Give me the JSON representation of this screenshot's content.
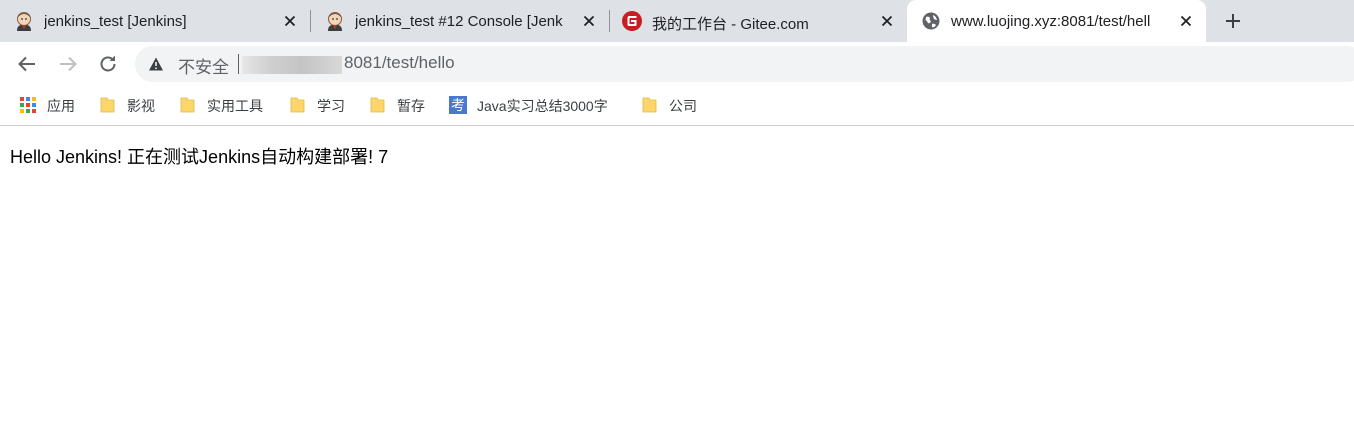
{
  "tabs": [
    {
      "title": "jenkins_test [Jenkins]",
      "icon": "jenkins-icon",
      "active": false
    },
    {
      "title": "jenkins_test #12 Console [Jenk",
      "icon": "jenkins-icon",
      "active": false
    },
    {
      "title": "我的工作台 - Gitee.com",
      "icon": "gitee-icon",
      "active": false
    },
    {
      "title": "www.luojing.xyz:8081/test/hell",
      "icon": "globe-icon",
      "active": true
    }
  ],
  "omnibox": {
    "security_label": "不安全",
    "separator": "|",
    "url_visible": "8081/test/hello"
  },
  "bookmarks": [
    {
      "label": "应用",
      "icon": "apps-grid-icon"
    },
    {
      "label": "影视",
      "icon": "folder-icon"
    },
    {
      "label": "实用工具",
      "icon": "folder-icon"
    },
    {
      "label": "学习",
      "icon": "folder-icon"
    },
    {
      "label": "暂存",
      "icon": "folder-icon"
    },
    {
      "label": "Java实习总结3000字",
      "icon": "kao-icon",
      "icon_char": "考"
    },
    {
      "label": "公司",
      "icon": "folder-icon"
    }
  ],
  "page": {
    "text": "Hello Jenkins! 正在测试Jenkins自动构建部署! 7"
  },
  "colors": {
    "tabstrip": "#dee1e6",
    "omnibox": "#f1f3f4",
    "folder": "#fcd66b",
    "gitee": "#c71d23",
    "kao": "#4a78d0"
  }
}
